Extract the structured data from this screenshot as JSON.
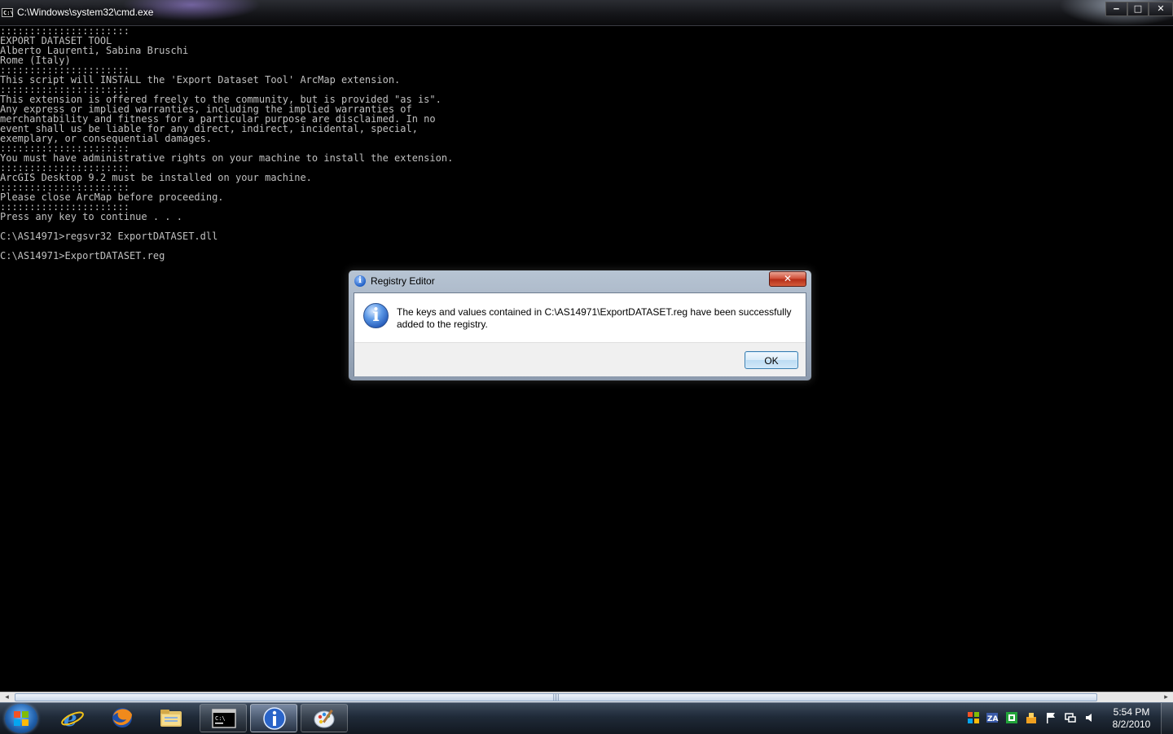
{
  "window": {
    "title": "C:\\Windows\\system32\\cmd.exe",
    "icon_text": "C:\\",
    "minimize": "‒",
    "maximize": "□",
    "close": "✕"
  },
  "console": {
    "lines": [
      "::::::::::::::::::::::",
      "EXPORT DATASET TOOL",
      "Alberto Laurenti, Sabina Bruschi",
      "Rome (Italy)",
      "::::::::::::::::::::::",
      "This script will INSTALL the 'Export Dataset Tool' ArcMap extension.",
      "::::::::::::::::::::::",
      "This extension is offered freely to the community, but is provided \"as is\".",
      "Any express or implied warranties, including the implied warranties of",
      "merchantability and fitness for a particular purpose are disclaimed. In no",
      "event shall us be liable for any direct, indirect, incidental, special,",
      "exemplary, or consequential damages.",
      "::::::::::::::::::::::",
      "You must have administrative rights on your machine to install the extension.",
      "::::::::::::::::::::::",
      "ArcGIS Desktop 9.2 must be installed on your machine.",
      "::::::::::::::::::::::",
      "Please close ArcMap before proceeding.",
      "::::::::::::::::::::::",
      "Press any key to continue . . .",
      "",
      "C:\\AS14971>regsvr32 ExportDATASET.dll",
      "",
      "C:\\AS14971>ExportDATASET.reg"
    ]
  },
  "scrollbar": {
    "left_arrow": "◂",
    "right_arrow": "▸",
    "grip": "|||"
  },
  "dialog": {
    "title": "Registry Editor",
    "title_icon": "i",
    "close": "✕",
    "message_icon": "i",
    "message_line1": "The keys and values contained in C:\\AS14971\\ExportDATASET.reg have been successfully",
    "message_line2": "added to the registry.",
    "ok_label": "OK"
  },
  "taskbar": {
    "items": [
      {
        "name": "internet-explorer",
        "icon": "ie-icon",
        "state": "pinned"
      },
      {
        "name": "firefox",
        "icon": "firefox-icon",
        "state": "pinned"
      },
      {
        "name": "windows-explorer",
        "icon": "folder-icon",
        "state": "pinned"
      },
      {
        "name": "command-prompt",
        "icon": "cmd-icon",
        "state": "open"
      },
      {
        "name": "registry-editor",
        "icon": "info-icon",
        "state": "active"
      },
      {
        "name": "paint",
        "icon": "palette-icon",
        "state": "open"
      }
    ],
    "clock_time": "5:54 PM",
    "clock_date": "8/2/2010",
    "colors": {
      "accent": "#1f5ea8",
      "text": "#c0c0c0"
    }
  }
}
